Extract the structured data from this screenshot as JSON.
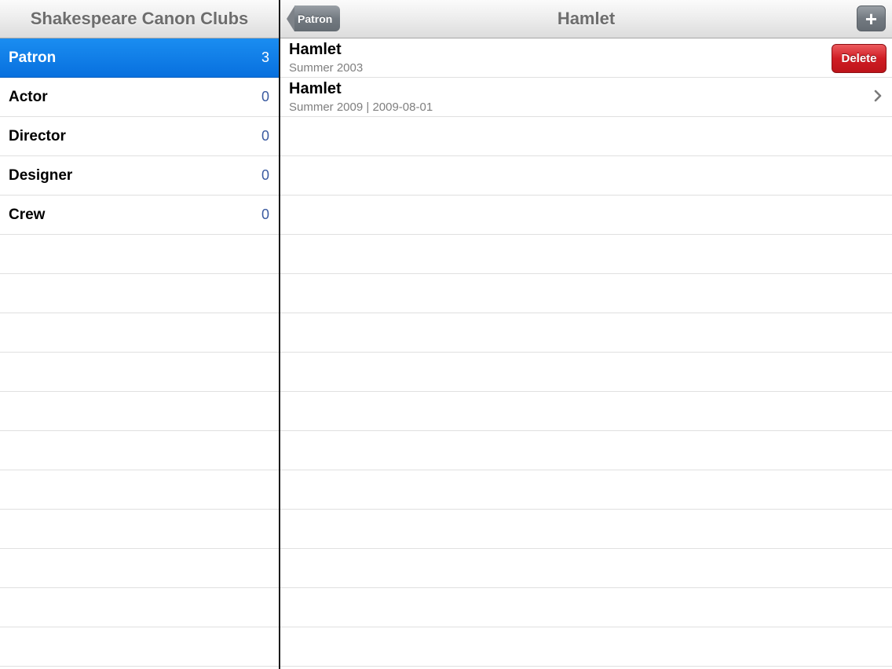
{
  "master": {
    "title": "Shakespeare Canon Clubs",
    "items": [
      {
        "label": "Patron",
        "count": "3",
        "selected": true
      },
      {
        "label": "Actor",
        "count": "0"
      },
      {
        "label": "Director",
        "count": "0"
      },
      {
        "label": "Designer",
        "count": "0"
      },
      {
        "label": "Crew",
        "count": "0"
      }
    ]
  },
  "detail": {
    "title": "Hamlet",
    "back_label": "Patron",
    "add_label": "+",
    "rows": [
      {
        "title": "Hamlet",
        "subtitle": "Summer 2003",
        "action": "Delete"
      },
      {
        "title": "Hamlet",
        "subtitle": "Summer 2009 | 2009-08-01",
        "accessory": "chevron-right-icon"
      }
    ]
  },
  "colors": {
    "selection": "#0a7ae4",
    "delete": "#d01d24",
    "count_text": "#3a5aa0"
  }
}
